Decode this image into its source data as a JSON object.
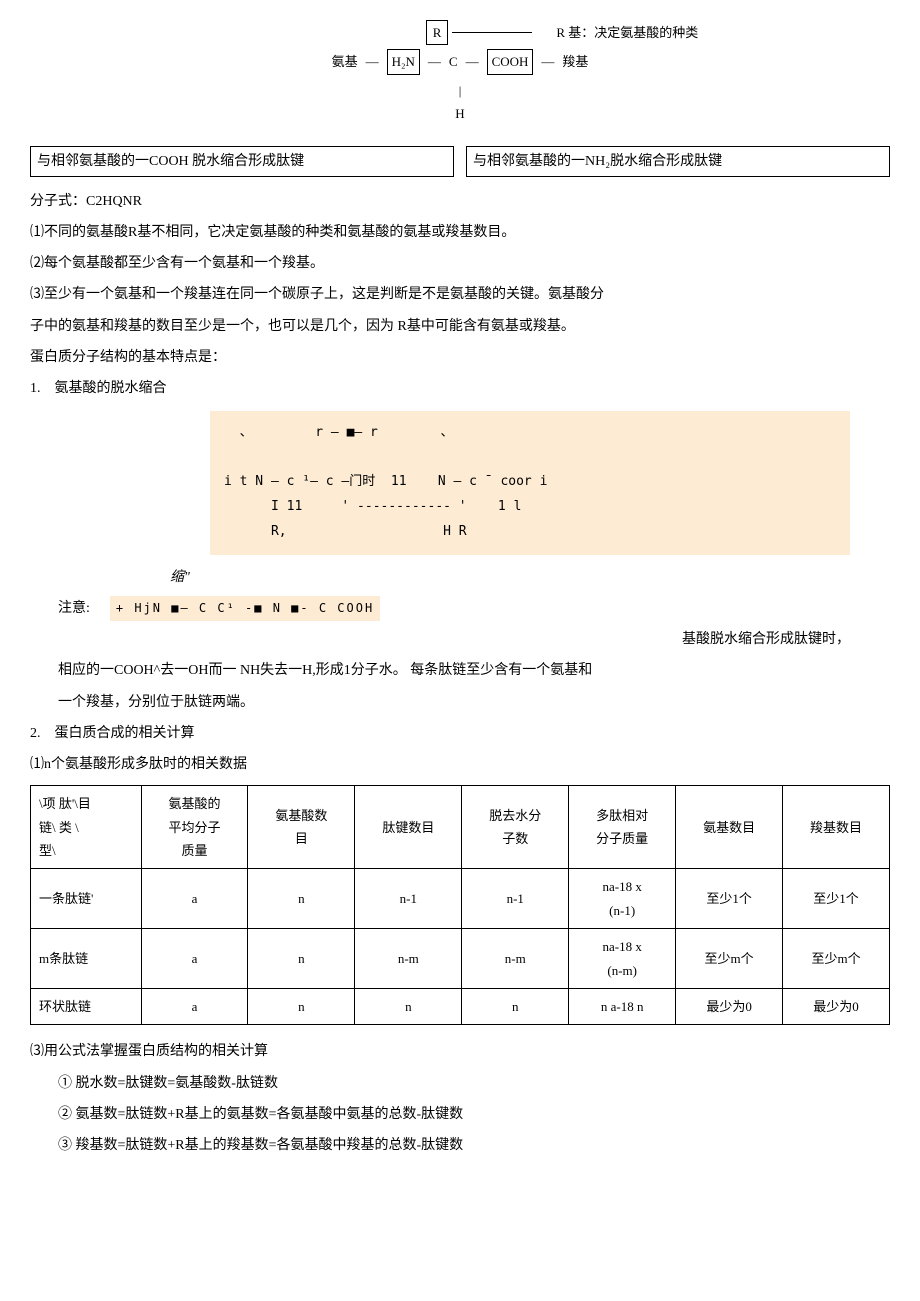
{
  "diagram_top": {
    "r_box": "R",
    "r_note": "R 基：决定氨基酸的种类",
    "amino_label": "氨基",
    "h2n_box": "H₂N",
    "c_center": "C",
    "cooh_box": "COOH",
    "carboxyl_label": "羧基",
    "h_bottom": "H",
    "left_bottom_box": "与相邻氨基酸的一COOH 脱水缩合形成肽键",
    "right_bottom_box": "与相邻氨基酸的一NH₂脱水缩合形成肽键"
  },
  "p1": "分子式：C2HQNR",
  "p2": "⑴不同的氨基酸R基不相同，它决定氨基酸的种类和氨基酸的氨基或羧基数目。",
  "p3": "⑵每个氨基酸都至少含有一个氨基和一个羧基。",
  "p4": "⑶至少有一个氨基和一个羧基连在同一个碳原子上，这是判断是不是氨基酸的关键。氨基酸分",
  "p4b": "子中的氨基和羧基的数目至少是一个，也可以是几个，因为               R基中可能含有氨基或羧基。",
  "p5": "蛋白质分子结构的基本特点是：",
  "item1": "1.　氨基酸的脱水缩合",
  "diagram_mid_lines": [
    "  、        r — ■— r        、",
    "",
    "i t N — c ¹— c ―门时  11    N — c ˉ coor i",
    "      I 11     ' ------------ '    1 l",
    "      R,                    H R"
  ],
  "diagram_mid_note": "缩\"",
  "note_prefix": "注意:",
  "note_mono": "+ HjN ■—    C    C¹ -■    N ■- C      COOH",
  "right_text": "基酸脱水缩合形成肽键时，",
  "p6": "相应的一COOH^去一OH而一 NH失去一H,形成1分子水。 每条肽链至少含有一个氨基和",
  "p6b": "一个羧基，分别位于肽链两端。",
  "item2": "2.　蛋白质合成的相关计算",
  "p7": "⑴n个氨基酸形成多肽时的相关数据",
  "table": {
    "header_rowlabel": "\\项 肽'\\目\n链\\ 类 \\\n型\\",
    "headers": [
      "氨基酸的\n平均分子\n质量",
      "氨基酸数\n目",
      "肽键数目",
      "脱去水分\n子数",
      "多肽相对\n分子质量",
      "氨基数目",
      "羧基数目"
    ],
    "rows": [
      {
        "label": "一条肽链'",
        "cells": [
          "a",
          "n",
          "n-1",
          "n-1",
          "na-18 x\n(n-1)",
          "至少1个",
          "至少1个"
        ]
      },
      {
        "label": "m条肽链",
        "cells": [
          "a",
          "n",
          "n-m",
          "n-m",
          "na-18 x\n(n-m)",
          "至少m个",
          "至少m个"
        ]
      },
      {
        "label": "环状肽链",
        "cells": [
          "a",
          "n",
          "n",
          "n",
          "n a-18 n",
          "最少为0",
          "最少为0"
        ]
      }
    ]
  },
  "p8": "⑶用公式法掌握蛋白质结构的相关计算",
  "formula1": "① 脱水数=肽键数=氨基酸数-肽链数",
  "formula2": "② 氨基数=肽链数+R基上的氨基数=各氨基酸中氨基的总数-肽键数",
  "formula3": "③ 羧基数=肽链数+R基上的羧基数=各氨基酸中羧基的总数-肽键数"
}
